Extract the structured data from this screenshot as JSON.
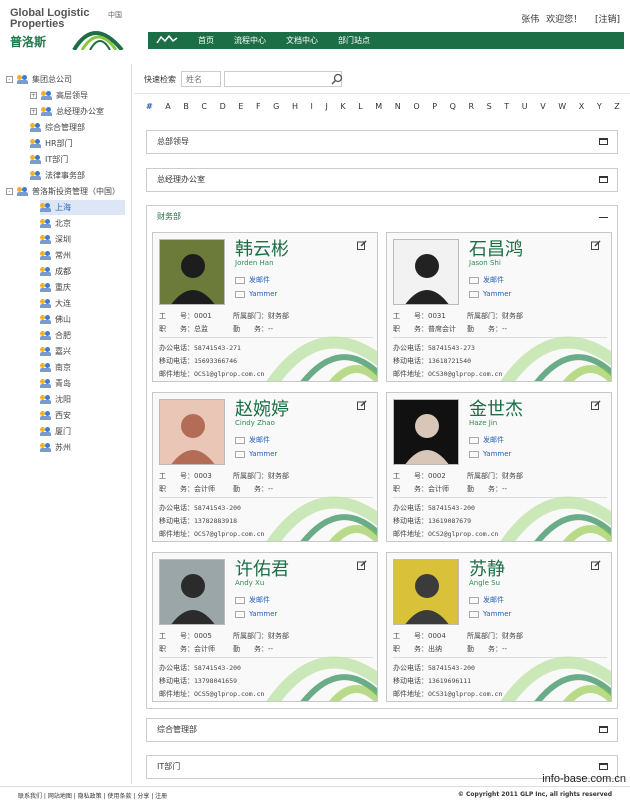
{
  "header": {
    "logo_en_1": "Global Logistic",
    "logo_en_2": "Properties",
    "logo_cn": "普洛斯",
    "logo_tag": "中国",
    "user_name": "张伟",
    "welcome": "欢迎您！",
    "logout": "[注销]"
  },
  "nav": {
    "items": [
      "首页",
      "流程中心",
      "文档中心",
      "部门站点"
    ]
  },
  "tree": {
    "root1": "集团总公司",
    "root1_children": [
      "高层领导",
      "总经理办公室",
      "综合管理部",
      "HR部门",
      "IT部门",
      "法律事务部"
    ],
    "root2": "普洛斯投资管理（中国）",
    "root2_children": [
      "上海",
      "北京",
      "深圳",
      "常州",
      "成都",
      "重庆",
      "大连",
      "佛山",
      "合肥",
      "嘉兴",
      "南京",
      "青岛",
      "沈阳",
      "西安",
      "厦门",
      "苏州"
    ],
    "selected": "上海"
  },
  "search": {
    "label": "快速检索",
    "name_placeholder": "姓名",
    "keyword_value": ""
  },
  "alphabet": [
    "#",
    "A",
    "B",
    "C",
    "D",
    "E",
    "F",
    "G",
    "H",
    "I",
    "J",
    "K",
    "L",
    "M",
    "N",
    "O",
    "P",
    "Q",
    "R",
    "S",
    "T",
    "U",
    "V",
    "W",
    "X",
    "Y",
    "Z"
  ],
  "sections": {
    "s1": "总部领导",
    "s2": "总经理办公室",
    "s3": "财务部",
    "s4": "综合管理部",
    "s5": "IT部门"
  },
  "card_labels": {
    "email": "发邮件",
    "yammer": "Yammer",
    "emp_no": "工　　号：",
    "title": "职　　务：",
    "dept": "所属部门：",
    "subtitle": "勤　　务：",
    "office_phone": "办公电话：",
    "mobile": "移动电话：",
    "mail_addr": "邮件地址："
  },
  "cards": [
    {
      "cn": "韩云彬",
      "en": "Jorden Han",
      "no": "0001",
      "title": "总监",
      "dept": "财务部",
      "sub": "--",
      "office": "58741543-271",
      "mobile": "15693366746",
      "mail": "OCS1@glprop.com.cn"
    },
    {
      "cn": "石昌鸿",
      "en": "Jason Shi",
      "no": "0031",
      "title": "普席会计",
      "dept": "财务部",
      "sub": "--",
      "office": "58741543-273",
      "mobile": "13618721540",
      "mail": "OCS30@glprop.com.cn"
    },
    {
      "cn": "赵婉婷",
      "en": "Cindy Zhao",
      "no": "0003",
      "title": "会计师",
      "dept": "财务部",
      "sub": "--",
      "office": "58741543-200",
      "mobile": "13782883918",
      "mail": "OCS7@glprop.com.cn"
    },
    {
      "cn": "金世杰",
      "en": "Haze Jin",
      "no": "0002",
      "title": "会计师",
      "dept": "财务部",
      "sub": "--",
      "office": "58741543-200",
      "mobile": "13619087679",
      "mail": "OCS2@glprop.com.cn"
    },
    {
      "cn": "许佑君",
      "en": "Andy Xu",
      "no": "0005",
      "title": "会计师",
      "dept": "财务部",
      "sub": "--",
      "office": "58741543-200",
      "mobile": "13798041659",
      "mail": "OCS5@glprop.com.cn"
    },
    {
      "cn": "苏静",
      "en": "Angle Su",
      "no": "0004",
      "title": "出纳",
      "dept": "财务部",
      "sub": "--",
      "office": "58741543-200",
      "mobile": "13619696111",
      "mail": "OCS31@glprop.com.cn"
    }
  ],
  "footer": {
    "links": "联系我们 | 网站地图 | 隐私政策 | 使用条款 | 分享 | 注册",
    "copyright": "© Copyright 2011 GLP Inc, all rights reserved"
  },
  "watermark": "info-base.com.cn",
  "colors": {
    "brand_green": "#1b6e46",
    "link_blue": "#2563b8"
  }
}
